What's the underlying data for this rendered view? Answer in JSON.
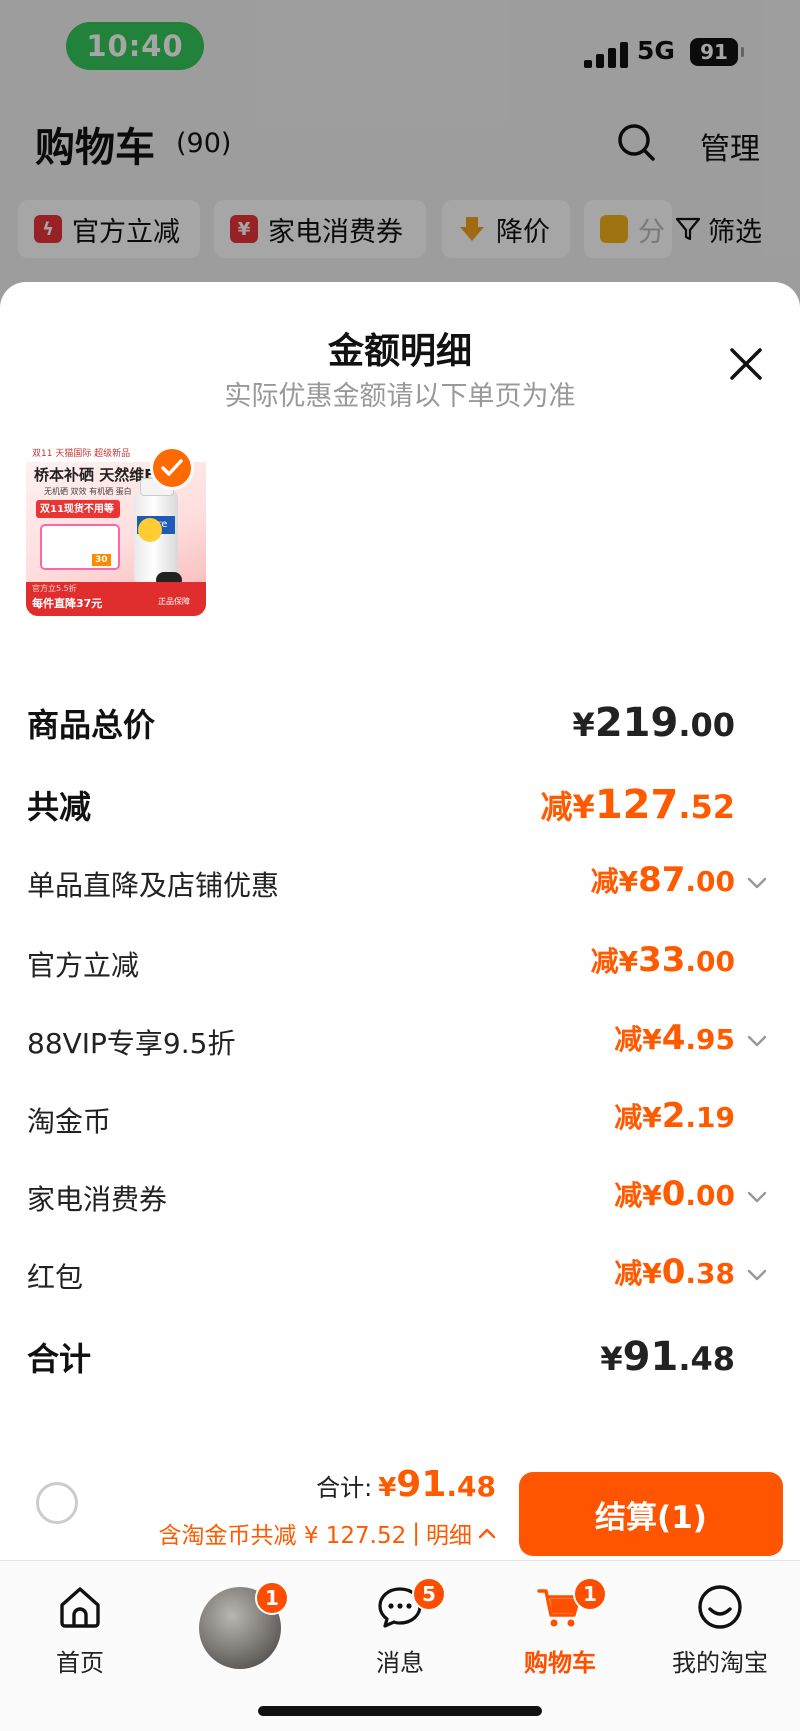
{
  "status_bar": {
    "time": "10:40",
    "network": "5G",
    "battery": "91"
  },
  "cart_header": {
    "title": "购物车",
    "count": "(90)",
    "manage_label": "管理"
  },
  "filters": [
    {
      "label": "官方立减",
      "icon": "lightning-icon",
      "color": "#e8353a"
    },
    {
      "label": "家电消费券",
      "icon": "coupon-icon",
      "color": "#e8353a"
    },
    {
      "label": "降价",
      "icon": "price-drop-icon",
      "color": "#f5a31a"
    },
    {
      "label": "分",
      "icon": "folder-icon",
      "color": "#f5b21a"
    }
  ],
  "filter_button": {
    "label": "筛选"
  },
  "sheet": {
    "title": "金额明细",
    "subtitle": "实际优惠金额请以下单页为准",
    "product_thumb": {
      "top_strip": "双11 天猫国际 超级新品",
      "headline": "桥本补硒 天然维E",
      "subline": "无机硒 双效 有机硒 蛋白",
      "promo": "双11现货不用等",
      "card_tag": "30",
      "bottle_brand": "pure",
      "footer_small": "官方立5.5折",
      "footer_main": "每件直降37元",
      "footer_right": "正品保障"
    }
  },
  "price_rows": [
    {
      "label": "商品总价",
      "prefix": "",
      "symbol": "¥",
      "int": "219",
      "dec": ".00",
      "bold": true,
      "orange": false,
      "chevron": false
    },
    {
      "label": "共减",
      "prefix": "减",
      "symbol": "¥",
      "int": "127",
      "dec": ".52",
      "bold": true,
      "orange": true,
      "chevron": false
    },
    {
      "label": "单品直降及店铺优惠",
      "prefix": "减",
      "symbol": "¥",
      "int": "87",
      "dec": ".00",
      "bold": false,
      "orange": true,
      "chevron": true
    },
    {
      "label": "官方立减",
      "prefix": "减",
      "symbol": "¥",
      "int": "33",
      "dec": ".00",
      "bold": false,
      "orange": true,
      "chevron": false
    },
    {
      "label": "88VIP专享9.5折",
      "prefix": "减",
      "symbol": "¥",
      "int": "4",
      "dec": ".95",
      "bold": false,
      "orange": true,
      "chevron": true
    },
    {
      "label": "淘金币",
      "prefix": "减",
      "symbol": "¥",
      "int": "2",
      "dec": ".19",
      "bold": false,
      "orange": true,
      "chevron": false
    },
    {
      "label": "家电消费券",
      "prefix": "减",
      "symbol": "¥",
      "int": "0",
      "dec": ".00",
      "bold": false,
      "orange": true,
      "chevron": true
    },
    {
      "label": "红包",
      "prefix": "减",
      "symbol": "¥",
      "int": "0",
      "dec": ".38",
      "bold": false,
      "orange": true,
      "chevron": true
    },
    {
      "label": "合计",
      "prefix": "",
      "symbol": "¥",
      "int": "91",
      "dec": ".48",
      "bold": true,
      "orange": false,
      "chevron": false
    }
  ],
  "checkout": {
    "total_label": "合计:",
    "total_symbol": "¥",
    "total_int": "91",
    "total_dec": ".48",
    "savings_text": "含淘金币共减 ¥ 127.52",
    "detail_label": "明细",
    "pay_button": "结算(1)"
  },
  "tabbar": [
    {
      "label": "首页",
      "icon": "home-icon",
      "badge": ""
    },
    {
      "label": "",
      "icon": "avatar",
      "badge": "1"
    },
    {
      "label": "消息",
      "icon": "message-icon",
      "badge": "5"
    },
    {
      "label": "购物车",
      "icon": "cart-icon",
      "badge": "1",
      "active": true
    },
    {
      "label": "我的淘宝",
      "icon": "smile-icon",
      "badge": ""
    }
  ],
  "colors": {
    "accent": "#ff5400",
    "status_green": "#35c759"
  }
}
